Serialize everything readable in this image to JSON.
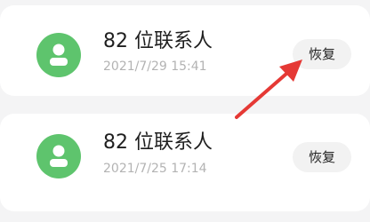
{
  "records": [
    {
      "title": "82 位联系人",
      "time": "2021/7/29 15:41",
      "restore_label": "恢复"
    },
    {
      "title": "82 位联系人",
      "time": "2021/7/25 17:14",
      "restore_label": "恢复"
    }
  ],
  "icons": {
    "avatar": "person-icon",
    "annotation": "red-arrow-annotation"
  },
  "colors": {
    "avatar_bg": "#5ec46d",
    "arrow": "#e53935",
    "button_bg": "#f2f2f2",
    "time_text": "#b3b3b3"
  }
}
